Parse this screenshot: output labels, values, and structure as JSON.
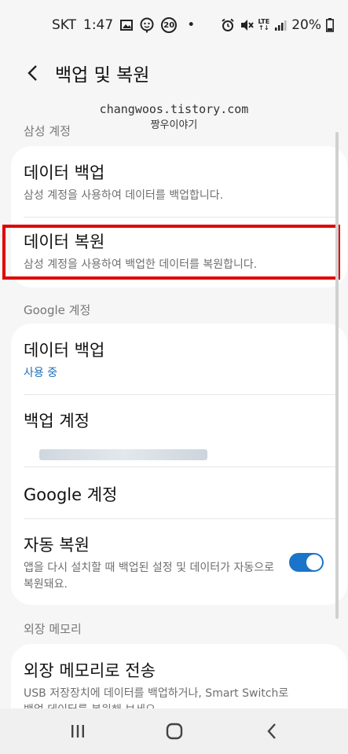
{
  "status_bar": {
    "carrier": "SKT",
    "time": "1:47",
    "notification_badge": "20",
    "dot": "•",
    "lte_label": "LTE",
    "battery_percent": "20%"
  },
  "header": {
    "title": "백업 및 복원"
  },
  "watermark": {
    "line1": "changwoos.tistory.com",
    "line2": "짱우이야기"
  },
  "sections": {
    "samsung_label": "삼성 계정",
    "google_label": "Google 계정",
    "external_label": "외장 메모리"
  },
  "samsung_items": {
    "backup_title": "데이터 백업",
    "backup_sub": "삼성 계정을 사용하여 데이터를 백업합니다.",
    "restore_title": "데이터 복원",
    "restore_sub": "삼성 계정을 사용하여 백업한 데이터를 복원합니다."
  },
  "google_items": {
    "backup_title": "데이터 백업",
    "backup_status": "사용 중",
    "account_title": "백업 계정",
    "google_account_title": "Google 계정",
    "auto_restore_title": "자동 복원",
    "auto_restore_sub": "앱을 다시 설치할 때 백업된 설정 및 데이터가 자동으로 복원돼요.",
    "auto_restore_enabled": true
  },
  "external_items": {
    "transfer_title": "외장 메모리로 전송",
    "transfer_sub": "USB 저장장치에 데이터를 백업하거나, Smart Switch로 백업 데이터를 복원해 보세요."
  },
  "colors": {
    "accent": "#1a74c9",
    "highlight": "#e00000",
    "status_active": "#1e6fb8"
  },
  "icons": {
    "status": [
      "gallery-icon",
      "face-icon",
      "badge-icon",
      "alarm-icon",
      "mute-icon",
      "signal-icon",
      "battery-icon"
    ],
    "nav": [
      "recents-icon",
      "home-icon",
      "back-icon"
    ]
  }
}
